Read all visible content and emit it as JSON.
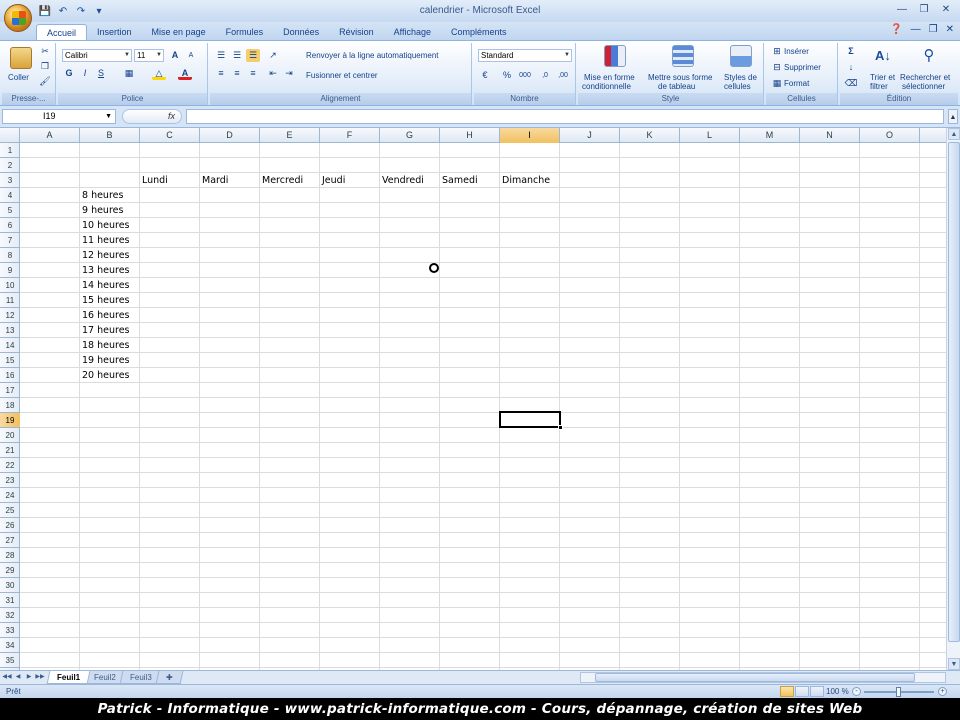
{
  "window": {
    "title": "calendrier - Microsoft Excel"
  },
  "ribbon": {
    "tabs": [
      "Accueil",
      "Insertion",
      "Mise en page",
      "Formules",
      "Données",
      "Révision",
      "Affichage",
      "Compléments"
    ],
    "active_tab": "Accueil",
    "clipboard": {
      "paste_label": "Coller",
      "group_label": "Presse-..."
    },
    "font": {
      "font_name": "Calibri",
      "font_size": "11",
      "group_label": "Police"
    },
    "alignment": {
      "wrap_text": "Renvoyer à la ligne automatiquement",
      "merge_center": "Fusionner et centrer",
      "group_label": "Alignement"
    },
    "number": {
      "format": "Standard",
      "group_label": "Nombre"
    },
    "styles": {
      "conditional": [
        "Mise en forme",
        "conditionnelle"
      ],
      "as_table": [
        "Mettre sous forme",
        "de tableau"
      ],
      "cell_styles": [
        "Styles de",
        "cellules"
      ],
      "group_label": "Style"
    },
    "cells": {
      "insert": "Insérer",
      "delete": "Supprimer",
      "format": "Format",
      "group_label": "Cellules"
    },
    "editing": {
      "sort_filter": [
        "Trier et",
        "filtrer"
      ],
      "find_select": [
        "Rechercher et",
        "sélectionner"
      ],
      "group_label": "Édition"
    }
  },
  "formula_bar": {
    "name_box": "I19",
    "fx": "fx",
    "formula": ""
  },
  "sheet": {
    "columns": [
      "A",
      "B",
      "C",
      "D",
      "E",
      "F",
      "G",
      "H",
      "I",
      "J",
      "K",
      "L",
      "M",
      "N",
      "O"
    ],
    "selected_column": "I",
    "rows": [
      "1",
      "2",
      "3",
      "4",
      "5",
      "6",
      "7",
      "8",
      "9",
      "10",
      "11",
      "12",
      "13",
      "14",
      "15",
      "16",
      "17",
      "18",
      "19",
      "20",
      "21",
      "22",
      "23",
      "24",
      "25",
      "26",
      "27",
      "28",
      "29",
      "30",
      "31",
      "32",
      "33",
      "34",
      "35"
    ],
    "selected_row": "19",
    "days": [
      "Lundi",
      "Mardi",
      "Mercredi",
      "Jeudi",
      "Vendredi",
      "Samedi",
      "Dimanche"
    ],
    "hours": [
      "8 heures",
      "9 heures",
      "10 heures",
      "11 heures",
      "12 heures",
      "13 heures",
      "14 heures",
      "15 heures",
      "16 heures",
      "17 heures",
      "18 heures",
      "19 heures",
      "20 heures"
    ],
    "active_cell": "I19"
  },
  "sheet_tabs": [
    "Feuil1",
    "Feuil2",
    "Feuil3"
  ],
  "active_sheet": "Feuil1",
  "status": {
    "text": "Prêt",
    "zoom": "100 %"
  },
  "banner": {
    "text": "Patrick - Informatique - www.patrick-informatique.com - Cours, dépannage, création de sites Web"
  }
}
